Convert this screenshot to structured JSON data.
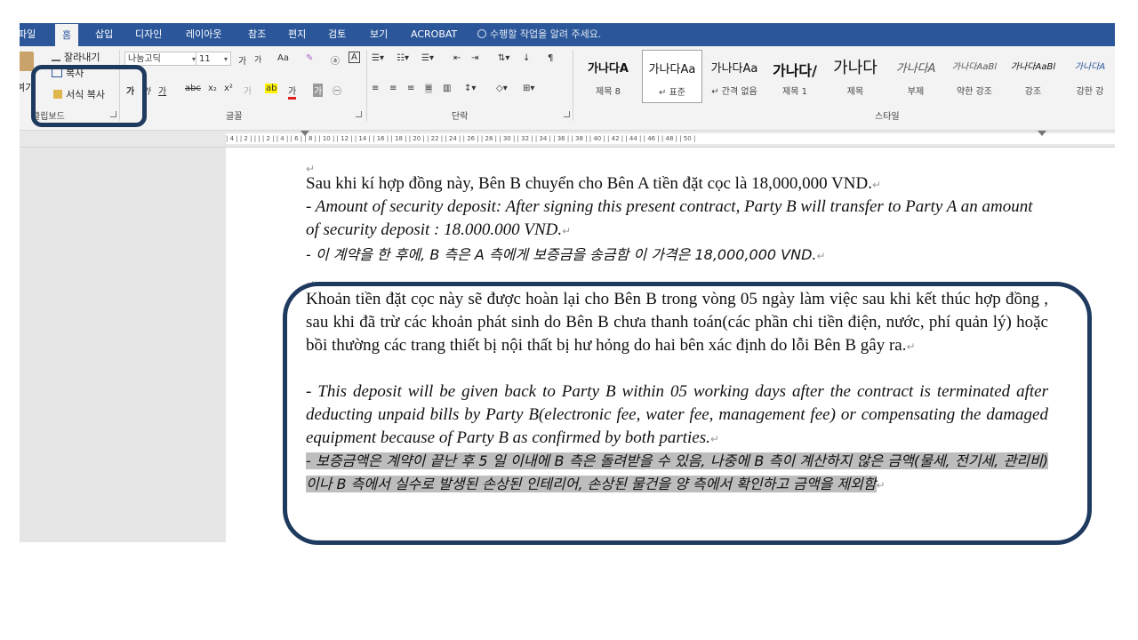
{
  "tabs": {
    "file": "파일",
    "home": "홈",
    "insert": "삽입",
    "design": "디자인",
    "layout": "레이아웃",
    "references": "참조",
    "mailings": "편지",
    "review": "검토",
    "view": "보기",
    "acrobat": "ACROBAT",
    "tell_me": "수행할 작업을 알려 주세요."
  },
  "clipboard": {
    "paste": "여기",
    "cut": "잘라내기",
    "copy": "복사",
    "format_painter": "서식 복사",
    "label": "클립보드"
  },
  "font": {
    "name": "나눔고딕",
    "size": "11",
    "label": "글꼴",
    "grow": "가",
    "shrink": "가",
    "case": "Aa",
    "bold": "가",
    "underline": "가"
  },
  "paragraph": {
    "label": "단락"
  },
  "styles": {
    "label": "스타일",
    "items": [
      {
        "sample": "가나다A",
        "name": "제목 8"
      },
      {
        "sample": "가나다Aa",
        "name": "↵ 표준"
      },
      {
        "sample": "가나다Aa",
        "name": "↵ 간격 없음"
      },
      {
        "sample": "가나다/",
        "name": "제목 1"
      },
      {
        "sample": "가나다",
        "name": "제목"
      },
      {
        "sample": "가나다A",
        "name": "부제"
      },
      {
        "sample": "가나다AaBl",
        "name": "약한 강조"
      },
      {
        "sample": "가나다AaBl",
        "name": "강조"
      },
      {
        "sample": "가나다A",
        "name": "강한 강"
      }
    ]
  },
  "ruler": {
    "ticks": "| 4 |   | 2 |   |   |   | 2 |   | 4 |   | 6 |   | 8 |   | 10 |   | 12 |   | 14 |   | 16 |   | 18 |   | 20 |   | 22 |   | 24 |   | 26 |   | 28 |   | 30 |   | 32 |   | 34 |   | 36 |   | 38 |   | 40 |   | 42 |   | 44 |   | 46 |   | 48 |   | 50 |"
  },
  "document": {
    "pmark": "↵",
    "p1_vi": "Sau khi kí hợp đồng này, Bên B chuyển cho Bên A tiền đặt cọc là 18,000,000 VND.",
    "p1_en": "- Amount of security deposit: After signing this present contract, Party B will transfer to Party A an amount of security deposit : 18.000.000 VND.",
    "p1_ko": "- 이 계약을 한 후에, B 측은 A 측에게 보증금을 송금함 이 가격은 18,000,000 VND.",
    "p2_vi": "Khoản tiền đặt cọc này sẽ được hoàn lại cho Bên B trong vòng 05 ngày làm việc sau khi kết thúc hợp đồng , sau khi đã trừ các khoản phát sinh do Bên B chưa thanh toán(các phần chi tiền điện, nước, phí quản lý) hoặc bồi thường các trang thiết bị nội thất bị hư hỏng do hai bên xác định do lỗi Bên B gây ra.",
    "p2_en": "- This deposit will be given back to Party B within 05 working days after the contract is terminated after deducting unpaid bills by Party B(electronic fee, water fee, management fee) or compensating the damaged equipment because of Party B as confirmed by both parties.",
    "p2_ko": "- 보증금액은 계약이 끝난 후 5 일 이내에 B 측은 돌려받을 수 있음, 나중에 B 측이 계산하지 않은 금액(물세, 전기세, 관리비)이나 B 측에서 실수로 발생된 손상된 인테리어, 손상된 물건을 양 측에서 확인하고 금액을 제외함"
  },
  "colors": {
    "tabbar": "#2b579a",
    "annotation": "#1f3a5f",
    "highlight": "#bdbdbd"
  }
}
